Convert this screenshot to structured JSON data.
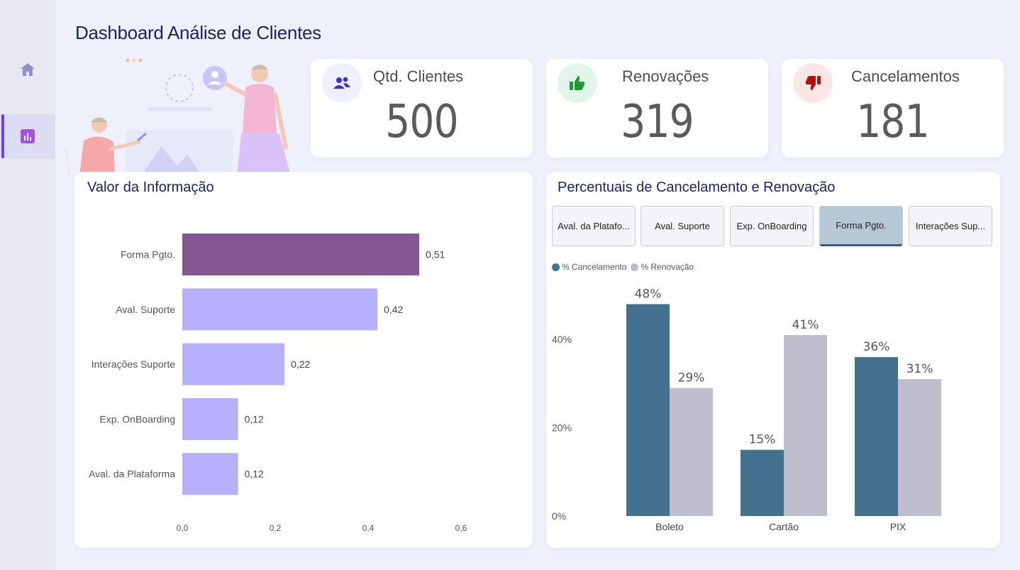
{
  "page": {
    "title": "Dashboard Análise de Clientes"
  },
  "sidebar": {
    "items": [
      {
        "icon": "home-icon",
        "active": false
      },
      {
        "icon": "bar-chart-icon",
        "active": true
      }
    ]
  },
  "kpis": [
    {
      "label": "Qtd. Clientes",
      "value": "500",
      "icon": "users-icon",
      "icon_bg": "#eef0fb",
      "icon_color": "#3a2fd6"
    },
    {
      "label": "Renovações",
      "value": "319",
      "icon": "thumbs-up-icon",
      "icon_bg": "#e3f5ea",
      "icon_color": "#1f9a38"
    },
    {
      "label": "Cancelamentos",
      "value": "181",
      "icon": "thumbs-down-icon",
      "icon_bg": "#fbe6e6",
      "icon_color": "#b01212"
    }
  ],
  "valor_panel": {
    "title": "Valor da Informação"
  },
  "percent_panel": {
    "title": "Percentuais de Cancelamento e Renovação",
    "tabs": [
      "Aval. da Platafo...",
      "Aval. Suporte",
      "Exp. OnBoarding",
      "Forma Pgto.",
      "Interações Sup..."
    ],
    "selected_tab": "Forma Pgto.",
    "legend": [
      "% Cancelamento",
      "% Renovação"
    ]
  },
  "chart_data": [
    {
      "type": "bar",
      "orientation": "horizontal",
      "title": "Valor da Informação",
      "categories": [
        "Forma Pgto.",
        "Aval. Suporte",
        "Interações Suporte",
        "Exp. OnBoarding",
        "Aval. da Plataforma"
      ],
      "values": [
        0.51,
        0.42,
        0.22,
        0.12,
        0.12
      ],
      "value_labels": [
        "0,51",
        "0,42",
        "0,22",
        "0,12",
        "0,12"
      ],
      "xlim": [
        0,
        0.6
      ],
      "x_ticks": [
        "0,0",
        "0,2",
        "0,4",
        "0,6"
      ],
      "colors": {
        "highlight": "#855594",
        "default": "#b7b0fc"
      },
      "grid": false
    },
    {
      "type": "bar",
      "title": "Percentuais de Cancelamento e Renovação",
      "categories": [
        "Boleto",
        "Cartão",
        "PIX"
      ],
      "series": [
        {
          "name": "% Cancelamento",
          "values": [
            48,
            15,
            36
          ],
          "labels": [
            "48%",
            "15%",
            "36%"
          ],
          "color": "#43718e"
        },
        {
          "name": "% Renovação",
          "values": [
            29,
            41,
            31
          ],
          "labels": [
            "29%",
            "41%",
            "31%"
          ],
          "color": "#bfbecc"
        }
      ],
      "ylim": [
        0,
        50
      ],
      "y_ticks": [
        "0%",
        "20%",
        "40%"
      ],
      "legend": "top-left",
      "grid": false
    }
  ]
}
